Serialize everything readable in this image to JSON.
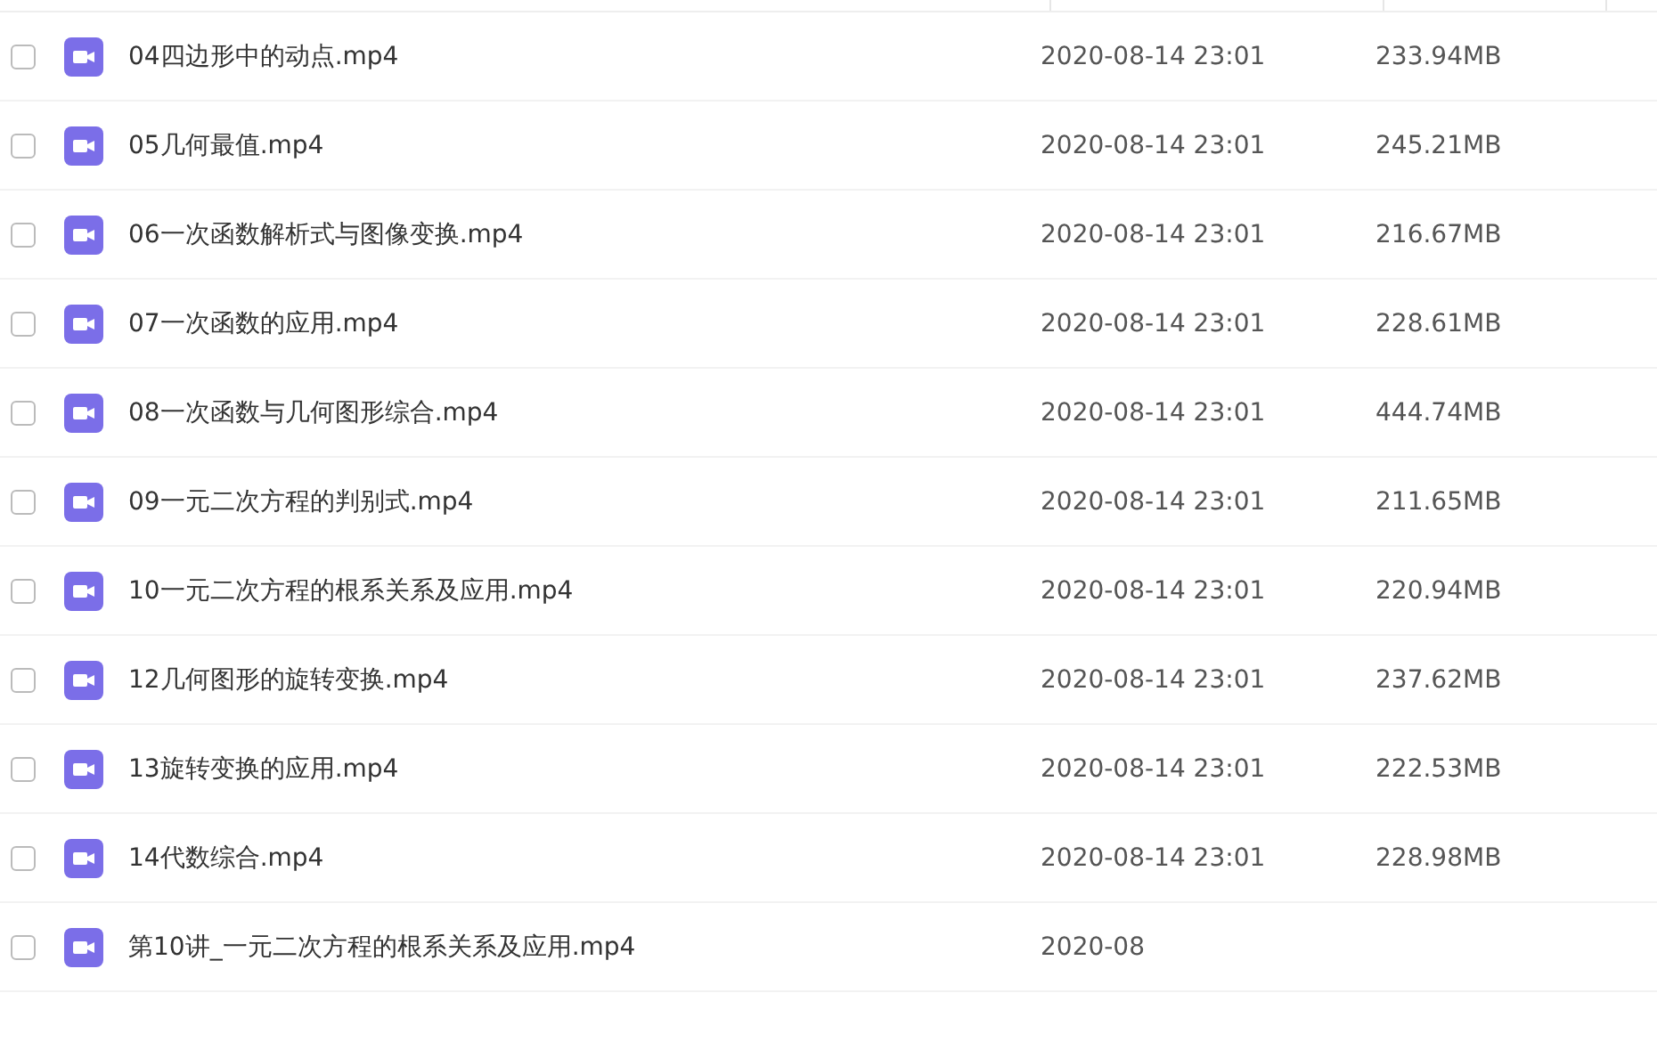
{
  "files": [
    {
      "name": "04四边形中的动点.mp4",
      "date": "2020-08-14 23:01",
      "size": "233.94MB",
      "checked": false
    },
    {
      "name": "05几何最值.mp4",
      "date": "2020-08-14 23:01",
      "size": "245.21MB",
      "checked": false
    },
    {
      "name": "06一次函数解析式与图像变换.mp4",
      "date": "2020-08-14 23:01",
      "size": "216.67MB",
      "checked": false
    },
    {
      "name": "07一次函数的应用.mp4",
      "date": "2020-08-14 23:01",
      "size": "228.61MB",
      "checked": false
    },
    {
      "name": "08一次函数与几何图形综合.mp4",
      "date": "2020-08-14 23:01",
      "size": "444.74MB",
      "checked": false
    },
    {
      "name": "09一元二次方程的判别式.mp4",
      "date": "2020-08-14 23:01",
      "size": "211.65MB",
      "checked": false
    },
    {
      "name": "10一元二次方程的根系关系及应用.mp4",
      "date": "2020-08-14 23:01",
      "size": "220.94MB",
      "checked": false
    },
    {
      "name": "12几何图形的旋转变换.mp4",
      "date": "2020-08-14 23:01",
      "size": "237.62MB",
      "checked": false
    },
    {
      "name": "13旋转变换的应用.mp4",
      "date": "2020-08-14 23:01",
      "size": "222.53MB",
      "checked": false
    },
    {
      "name": "14代数综合.mp4",
      "date": "2020-08-14 23:01",
      "size": "228.98MB",
      "checked": false
    },
    {
      "name": "第10讲_一元二次方程的根系关系及应用.mp4",
      "date": "2020-08",
      "checked": false
    }
  ]
}
